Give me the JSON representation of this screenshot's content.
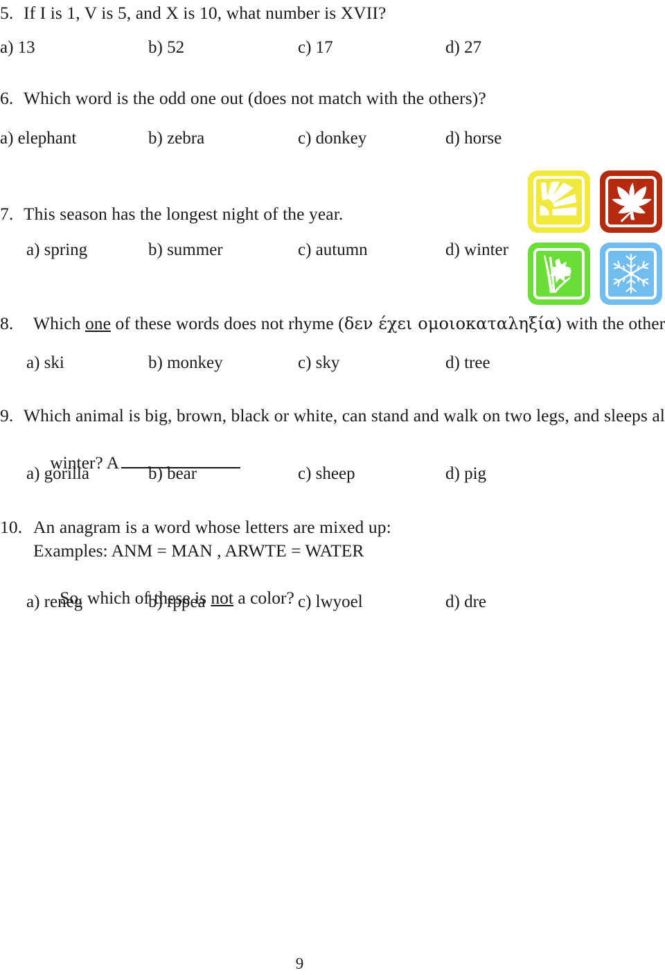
{
  "document": {
    "page_number": "9"
  },
  "questions": [
    {
      "number": "5.",
      "text": "If I is 1, V is 5, and X is 10, what number is XVII?",
      "options": [
        {
          "label": "a) 13"
        },
        {
          "label": "b) 52"
        },
        {
          "label": "c) 17"
        },
        {
          "label": "d) 27"
        }
      ]
    },
    {
      "number": "6.",
      "text": "Which word is the odd one out (does not match with the others)?",
      "options": [
        {
          "label": "a) elephant"
        },
        {
          "label": "b) zebra"
        },
        {
          "label": "c) donkey"
        },
        {
          "label": "d) horse"
        }
      ]
    },
    {
      "number": "7.",
      "text": "This season has the longest night of the year.",
      "options": [
        {
          "label": "a) spring"
        },
        {
          "label": "b) summer"
        },
        {
          "label": "c) autumn"
        },
        {
          "label": "d) winter"
        }
      ]
    },
    {
      "number": "8.",
      "text_parts": {
        "before_underline": "Which ",
        "underlined": "one",
        "after_underline": " of these words does not rhyme (",
        "greek": "δεν έχει ομοιοκαταληξία",
        "tail": ") with the others?"
      },
      "options": [
        {
          "label": "a) ski"
        },
        {
          "label": "b) monkey"
        },
        {
          "label": "c) sky"
        },
        {
          "label": "d) tree"
        }
      ]
    },
    {
      "number": "9.",
      "line1": "Which animal is big, brown, black or white, can stand and walk on two legs, and sleeps all",
      "line2_before_blank": "winter? A",
      "options": [
        {
          "label": "a) gorilla"
        },
        {
          "label": "b) bear"
        },
        {
          "label": "c) sheep"
        },
        {
          "label": "d) pig"
        }
      ]
    },
    {
      "number": "10.",
      "line1": "An anagram is a word whose letters are mixed up:",
      "line2": "Examples: ANM = MAN , ARWTE = WATER",
      "line3_before_underline": "So, which of these is ",
      "line3_underlined": "not",
      "line3_after_underline": " a color?",
      "options": [
        {
          "label": "a) reneg"
        },
        {
          "label": "b) rppea"
        },
        {
          "label": "c) lwyoel"
        },
        {
          "label": "d) dre"
        }
      ]
    }
  ],
  "season_icons": [
    {
      "name": "summer-sun-icon",
      "season": "summer",
      "color": "#f2e83c"
    },
    {
      "name": "autumn-leaf-icon",
      "season": "autumn",
      "color": "#b62a10"
    },
    {
      "name": "spring-flower-icon",
      "season": "spring",
      "color": "#6ade36"
    },
    {
      "name": "winter-snowflake-icon",
      "season": "winter",
      "color": "#72bdef"
    }
  ]
}
